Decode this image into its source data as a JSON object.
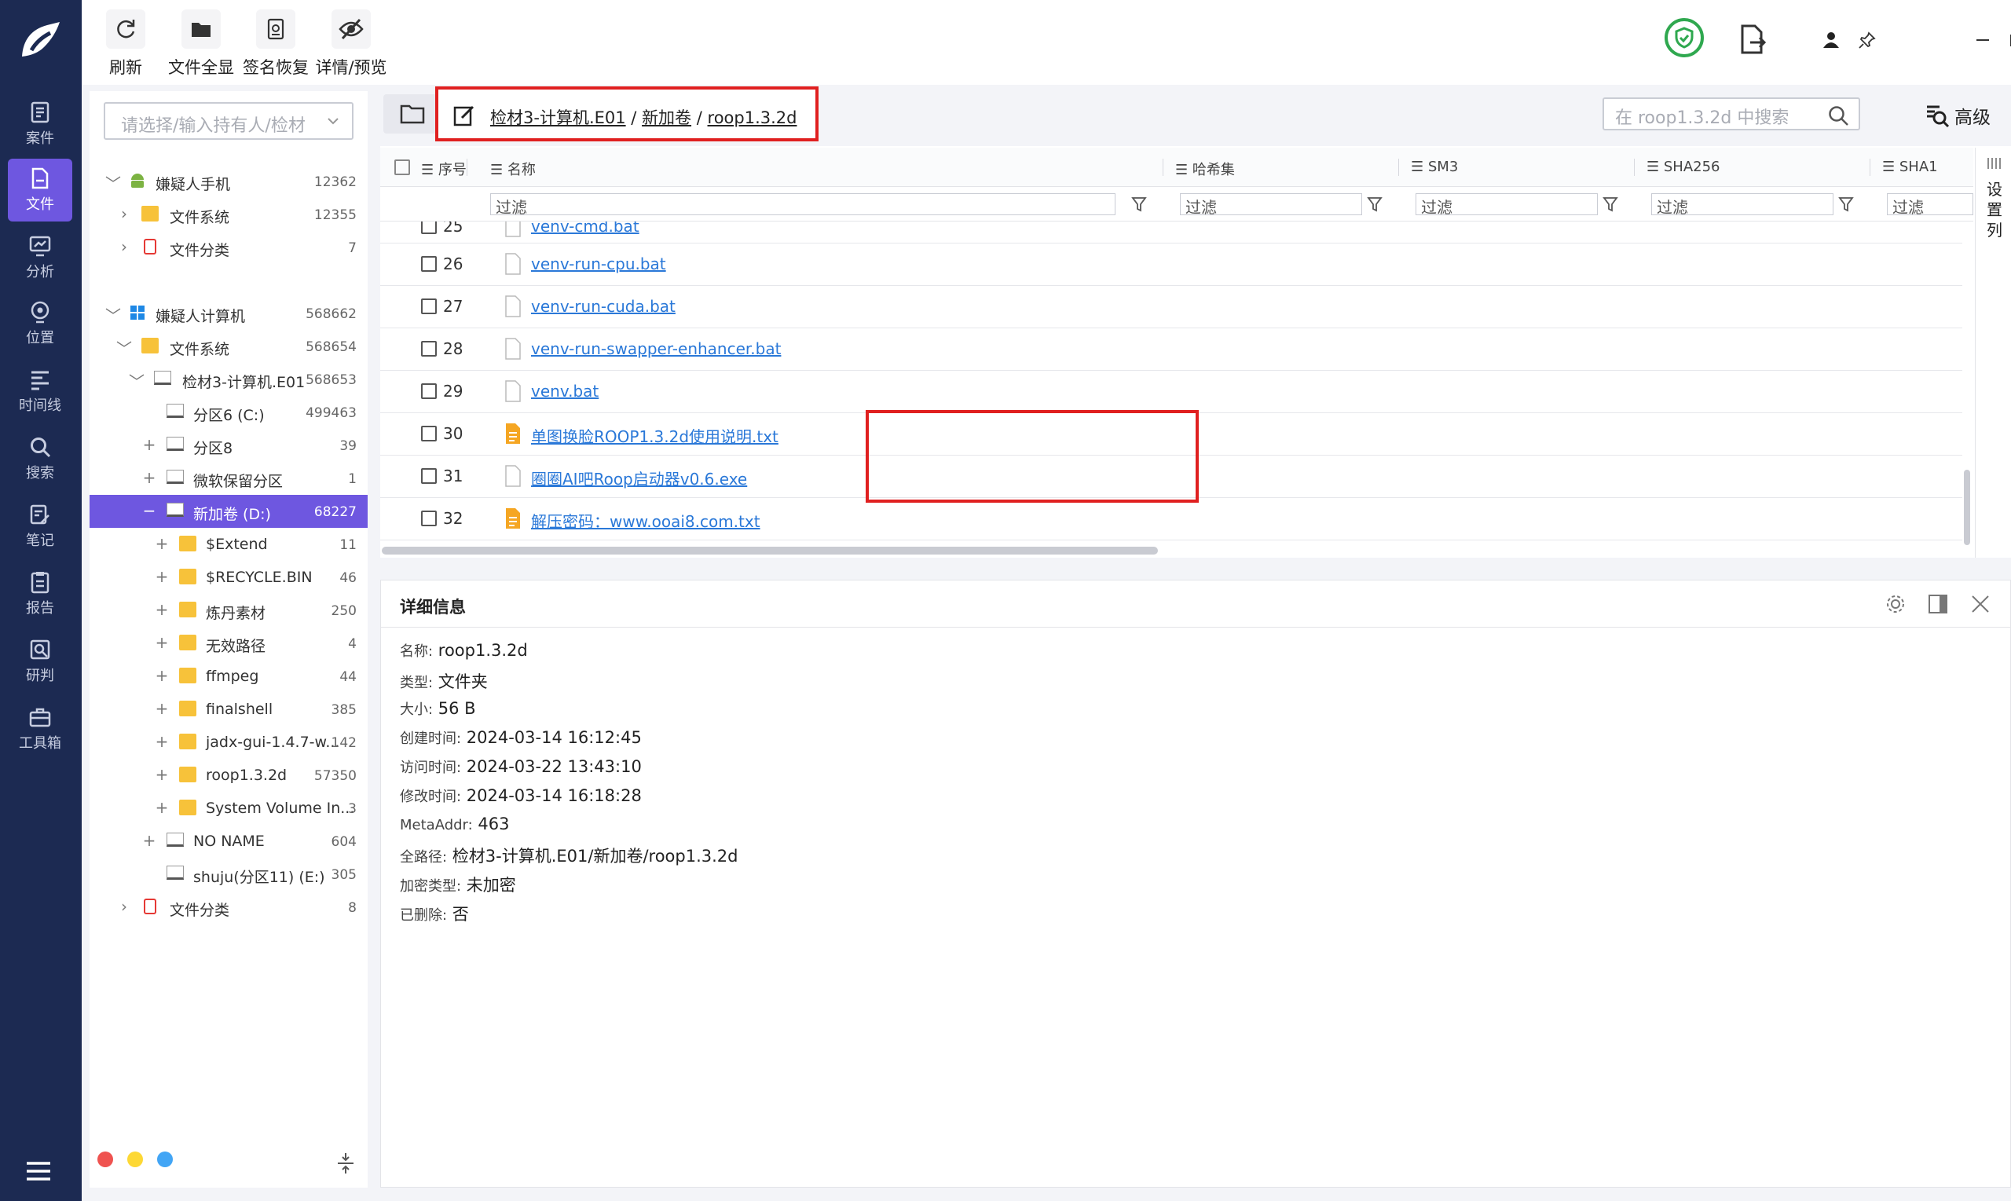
{
  "nav": {
    "items": [
      {
        "label": "案件",
        "icon": "case-icon"
      },
      {
        "label": "文件",
        "icon": "file-icon"
      },
      {
        "label": "分析",
        "icon": "analysis-icon"
      },
      {
        "label": "位置",
        "icon": "location-icon"
      },
      {
        "label": "时间线",
        "icon": "timeline-icon"
      },
      {
        "label": "搜索",
        "icon": "search-icon"
      },
      {
        "label": "笔记",
        "icon": "note-icon"
      },
      {
        "label": "报告",
        "icon": "report-icon"
      },
      {
        "label": "研判",
        "icon": "judge-icon"
      },
      {
        "label": "工具箱",
        "icon": "toolbox-icon"
      }
    ],
    "active": "文件"
  },
  "toolbar": {
    "refresh": "刷新",
    "show_all": "文件全显",
    "sign_restore": "签名恢复",
    "detail_preview": "详情/预览"
  },
  "tree": {
    "placeholder": "请选择/输入持有人/检材",
    "rows": [
      {
        "label": "嫌疑人手机",
        "count": "12362"
      },
      {
        "label": "文件系统",
        "count": "12355"
      },
      {
        "label": "文件分类",
        "count": "7"
      },
      {
        "label": "嫌疑人计算机",
        "count": "568662"
      },
      {
        "label": "文件系统",
        "count": "568654"
      },
      {
        "label": "检材3-计算机.E01",
        "count": "568653"
      },
      {
        "label": "分区6 (C:)",
        "count": "499463"
      },
      {
        "label": "分区8",
        "count": "39"
      },
      {
        "label": "微软保留分区",
        "count": "1"
      },
      {
        "label": "新加卷 (D:)",
        "count": "68227"
      },
      {
        "label": "$Extend",
        "count": "11"
      },
      {
        "label": "$RECYCLE.BIN",
        "count": "46"
      },
      {
        "label": "炼丹素材",
        "count": "250"
      },
      {
        "label": "无效路径",
        "count": "4"
      },
      {
        "label": "ffmpeg",
        "count": "44"
      },
      {
        "label": "finalshell",
        "count": "385"
      },
      {
        "label": "jadx-gui-1.4.7-w...",
        "count": "142"
      },
      {
        "label": "roop1.3.2d",
        "count": "57350"
      },
      {
        "label": "System Volume In...",
        "count": "3"
      },
      {
        "label": "NO NAME",
        "count": "604"
      },
      {
        "label": "shuju(分区11) (E:)",
        "count": "305"
      },
      {
        "label": "文件分类",
        "count": "8"
      }
    ]
  },
  "path": {
    "seg1": "检材3-计算机.E01",
    "seg2": "新加卷",
    "seg3": "roop1.3.2d",
    "sep": "/"
  },
  "search": {
    "placeholder": "在 roop1.3.2d 中搜索",
    "advanced": "高级"
  },
  "columns": {
    "index": "序号",
    "name": "名称",
    "hashset": "哈希集",
    "sm3": "SM3",
    "sha256": "SHA256",
    "sha1": "SHA1",
    "filter": "过滤",
    "set_columns": "设置列"
  },
  "files": [
    {
      "num": "25",
      "name": "venv-cmd.bat",
      "type": "bat"
    },
    {
      "num": "26",
      "name": "venv-run-cpu.bat",
      "type": "bat"
    },
    {
      "num": "27",
      "name": "venv-run-cuda.bat",
      "type": "bat"
    },
    {
      "num": "28",
      "name": "venv-run-swapper-enhancer.bat",
      "type": "bat"
    },
    {
      "num": "29",
      "name": "venv.bat",
      "type": "bat"
    },
    {
      "num": "30",
      "name": "单图换脸ROOP1.3.2d使用说明.txt",
      "type": "txt"
    },
    {
      "num": "31",
      "name": "圈圈AI吧Roop启动器v0.6.exe",
      "type": "exe"
    },
    {
      "num": "32",
      "name": "解压密码：www.ooai8.com.txt",
      "type": "txt"
    }
  ],
  "detail": {
    "title": "详细信息",
    "props": [
      {
        "k": "名称:",
        "v": "roop1.3.2d"
      },
      {
        "k": "类型:",
        "v": "文件夹"
      },
      {
        "k": "大小:",
        "v": "56 B"
      },
      {
        "k": "创建时间:",
        "v": "2024-03-14 16:12:45"
      },
      {
        "k": "访问时间:",
        "v": "2024-03-22 13:43:10"
      },
      {
        "k": "修改时间:",
        "v": "2024-03-14 16:18:28"
      },
      {
        "k": "MetaAddr:",
        "v": "463"
      },
      {
        "k": "全路径:",
        "v": "检材3-计算机.E01/新加卷/roop1.3.2d"
      },
      {
        "k": "加密类型:",
        "v": "未加密"
      },
      {
        "k": "已删除:",
        "v": "否"
      }
    ]
  },
  "colors": {
    "nav_bg": "#1c2a52",
    "accent": "#6e57e0",
    "link": "#2a78d8",
    "highlight_box": "#e02020",
    "folder": "#f7c23a",
    "txt_icon": "#f5a623"
  }
}
